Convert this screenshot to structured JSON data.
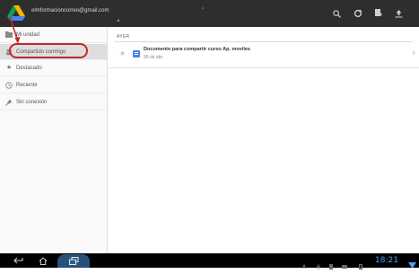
{
  "action_bar": {
    "account": "elmformacioncorreo@gmail.com",
    "center_marker": "”",
    "icons": [
      "search-icon",
      "refresh-icon",
      "new-document-icon",
      "upload-icon"
    ]
  },
  "sidebar": {
    "items": [
      {
        "label": "Mi unidad",
        "icon": "drive-folder-icon"
      },
      {
        "label": "Compartido conmigo",
        "icon": "shared-icon",
        "selected": true
      },
      {
        "label": "Destacado",
        "icon": "star-icon"
      },
      {
        "label": "Reciente",
        "icon": "clock-icon"
      },
      {
        "label": "Sin conexión",
        "icon": "pin-icon"
      }
    ]
  },
  "content": {
    "section_header": "AYER",
    "documents": [
      {
        "title": "Documento para compartir curso Ap. moviles",
        "date": "30 de abr."
      }
    ]
  },
  "system_bar": {
    "clock": "18:21",
    "accent_color": "#4aa3ff"
  },
  "annotation": {
    "highlight_color": "#c62828"
  }
}
